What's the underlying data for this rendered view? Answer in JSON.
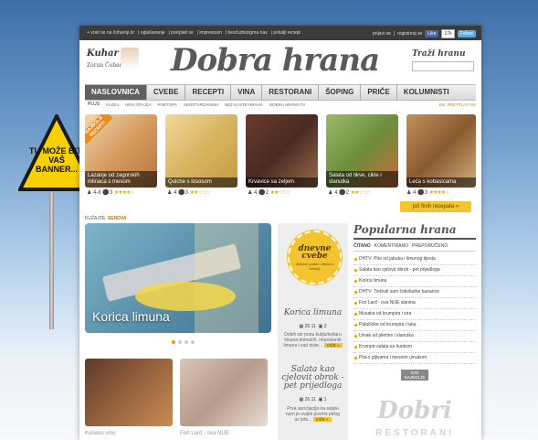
{
  "topbar": {
    "links": [
      "+ vrati se na čoharoji.hr",
      "oglašavanje",
      "pretplati se",
      "impressum",
      "besčudnizigrna nas",
      "pošalji recept"
    ],
    "right": [
      "prijavi se",
      "registriraj se"
    ],
    "fb_label": "Like",
    "fb_count": "17k",
    "tw_label": "Follow"
  },
  "header": {
    "kuhar_line1": "Kuhar",
    "kuhar_line2": "Zoran Čobanov",
    "logo": "Dobra hrana",
    "search_label": "Traži hranu",
    "search_placeholder": ""
  },
  "nav": {
    "items": [
      "NASLOVNICA",
      "CVEBE",
      "RECEPTI",
      "VINA",
      "RESTORANI",
      "ŠOPING",
      "PRIČE",
      "KOLUMNISTI"
    ]
  },
  "subnav": {
    "items": [
      "PLUS",
      "KUŽILI",
      "HRIA ŠPAJZA",
      "PIJETOPA",
      "VEGETARIJANSKI",
      "SEZ KASTE HRANA",
      "DOBRA HRANA TV"
    ],
    "dn_label": "DN: PRETPLATI SE"
  },
  "cards": [
    {
      "title": "Lazanje od zagorskih mlinaca s mesom",
      "persons": "4-8",
      "pots": "3",
      "ribbon": "NAJBOLJI RECEPTI"
    },
    {
      "title": "Quiche s lososom",
      "persons": "4",
      "pots": "3"
    },
    {
      "title": "Krvavice sa zeljem",
      "persons": "4",
      "pots": "2"
    },
    {
      "title": "Salata od tikve, cikle i slanutka",
      "persons": "4",
      "pots": "2"
    },
    {
      "title": "Leća s kobasicama",
      "persons": "4",
      "pots": "3"
    }
  ],
  "more_recipes": "još finih recepata »",
  "kuzajte": {
    "prefix": "KUŽAJTE:",
    "value": "SENDVA"
  },
  "feature": {
    "title": "Korica limuna"
  },
  "small_items": [
    "Kuhano vino",
    "Fort Lard - ova NIJE"
  ],
  "daily": {
    "badge_title": "dnevne cvebe",
    "badge_sub": "dnevne cvebe i trikovi u kuhinji",
    "item1": {
      "title": "Korica limuna",
      "date": "26.11",
      "comments": "2",
      "text": "Dobili ste punu kutiju/košaru limuna domaćih, nepr­skanih limuna i sad niste...",
      "more": "VIŠE »"
    },
    "item2": {
      "title": "Salata kao cjelovit obrok - pet prijedloga",
      "date": "26.11",
      "comments": "1",
      "text": "Prva asocijacija na salatu nam je uvijek povrtni prilog uz jela...",
      "more": "VIŠE »"
    }
  },
  "popular": {
    "title": "Popularna hrana",
    "tabs": [
      "ČITANO",
      "KOMENTIRANO",
      "PREPORUČENO"
    ],
    "items": [
      "DHTV: Pita od jabuka i limunog tijesta",
      "Salata kao cjelovit obrok - pet prijedloga",
      "Korica limuna",
      "DHTV: Tortirali sam čokoladne banance",
      "Fox Lard - ova NIJE slanina",
      "Musaka od krumpira i sira",
      "Palačinke od krumpira i luka",
      "Umak od piletine i slanutka",
      "Krumpir-salata sa šunkom",
      "Pita s gljivama i mesnim umakom"
    ],
    "all": "SVE NAJBOLJE"
  },
  "dobri": {
    "line1": "Dobri",
    "line2": "RESTORANI"
  },
  "sign": {
    "text": "TU MOŽE BITI VAŠ BANNER..."
  }
}
